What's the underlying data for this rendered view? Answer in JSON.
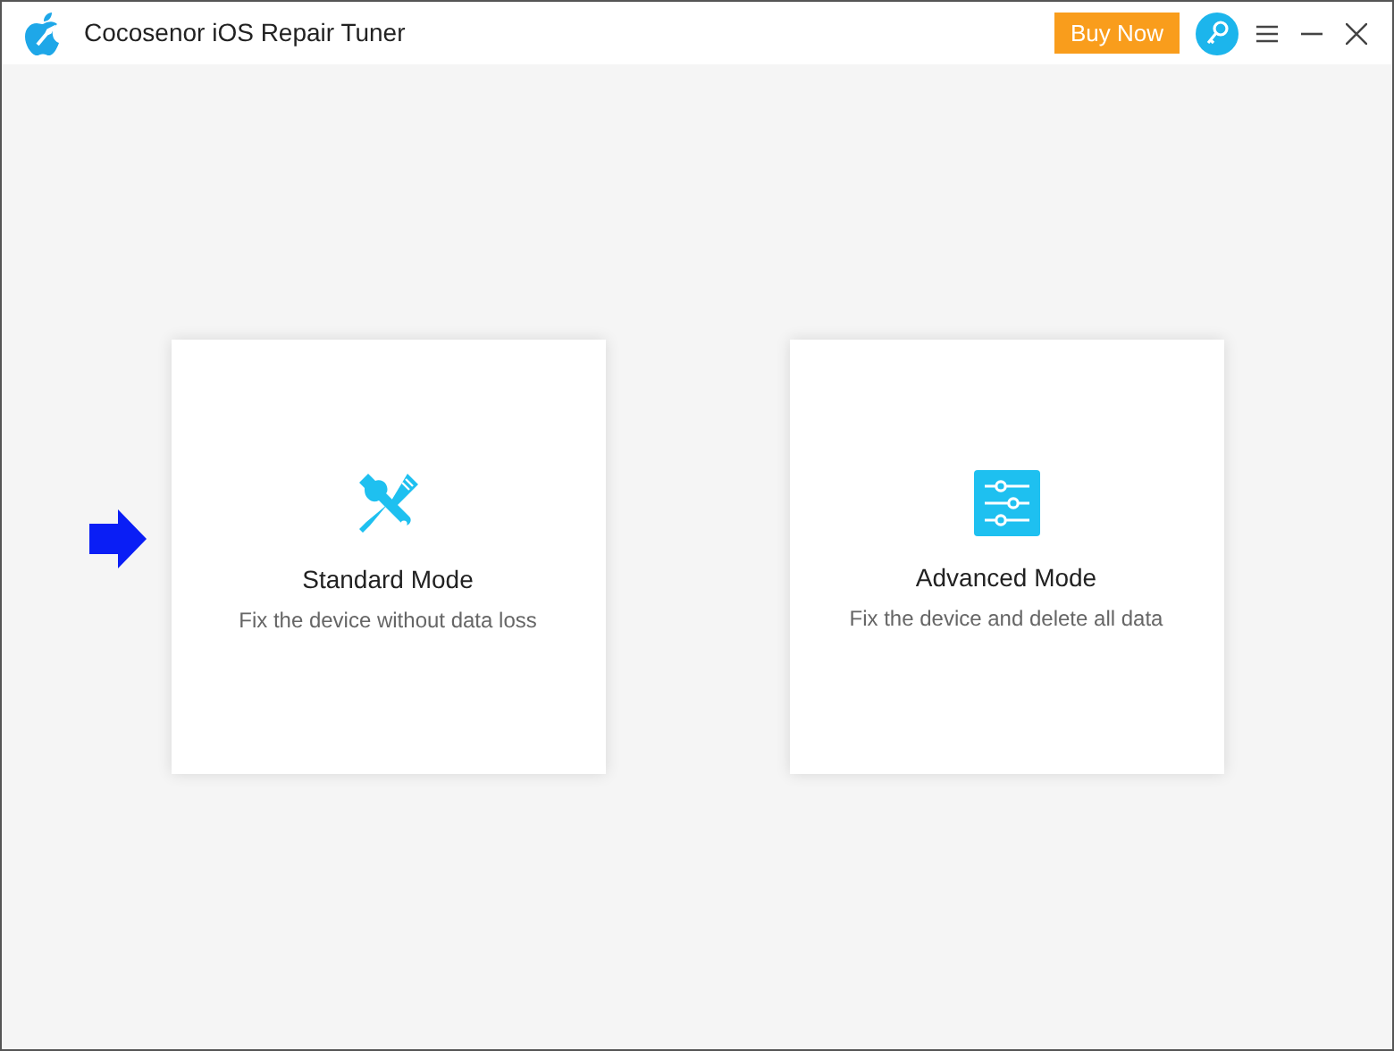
{
  "window": {
    "title": "Cocosenor iOS Repair Tuner",
    "buy_button": "Buy Now"
  },
  "modes": [
    {
      "kind": "tools",
      "title": "Standard Mode",
      "description": "Fix the device without data loss"
    },
    {
      "kind": "sliders",
      "title": "Advanced Mode",
      "description": "Fix the device and delete all data"
    }
  ]
}
